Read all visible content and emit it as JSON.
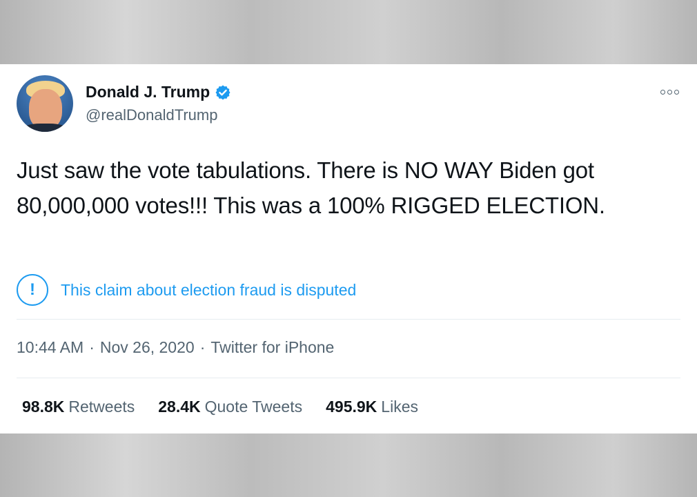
{
  "tweet": {
    "author": {
      "name": "Donald J. Trump",
      "handle": "@realDonaldTrump",
      "verified_icon": "verified-badge-icon"
    },
    "text": "Just saw the vote tabulations. There is NO WAY Biden got 80,000,000 votes!!! This was a 100% RIGGED ELECTION.",
    "notice": {
      "icon": "exclamation-circle-icon",
      "text": "This claim about election fraud is disputed"
    },
    "meta": {
      "time": "10:44 AM",
      "sep1": "·",
      "date": "Nov 26, 2020",
      "sep2": "·",
      "source": "Twitter for iPhone"
    },
    "stats": {
      "retweets": {
        "count": "98.8K",
        "label": "Retweets"
      },
      "quotes": {
        "count": "28.4K",
        "label": "Quote Tweets"
      },
      "likes": {
        "count": "495.9K",
        "label": "Likes"
      }
    }
  },
  "colors": {
    "accent": "#1d9bf0",
    "text": "#0f1419",
    "secondary": "#536471"
  }
}
